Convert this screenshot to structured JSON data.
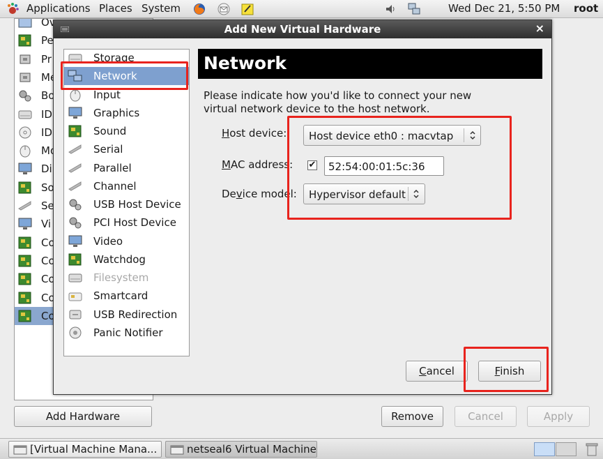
{
  "top_panel": {
    "menus": [
      "Applications",
      "Places",
      "System"
    ],
    "clock": "Wed Dec 21,  5:50 PM",
    "user": "root"
  },
  "background_window": {
    "hardware_items": [
      {
        "label": "Ov",
        "icon": "overview-icon"
      },
      {
        "label": "Pe",
        "icon": "performance-icon"
      },
      {
        "label": "Pr",
        "icon": "processor-icon"
      },
      {
        "label": "Me",
        "icon": "memory-icon"
      },
      {
        "label": "Bo",
        "icon": "boot-options-icon"
      },
      {
        "label": "ID",
        "icon": "disk-icon"
      },
      {
        "label": "ID",
        "icon": "cdrom-icon"
      },
      {
        "label": "Mo",
        "icon": "mouse-icon"
      },
      {
        "label": "Di",
        "icon": "display-icon"
      },
      {
        "label": "So",
        "icon": "sound-icon"
      },
      {
        "label": "Se",
        "icon": "serial-icon"
      },
      {
        "label": "Vi",
        "icon": "video-icon"
      },
      {
        "label": "Co",
        "icon": "controller-icon"
      },
      {
        "label": "Co",
        "icon": "controller-icon"
      },
      {
        "label": "Co",
        "icon": "controller-icon"
      },
      {
        "label": "Co",
        "icon": "controller-icon"
      },
      {
        "label": "Co",
        "icon": "controller-icon"
      }
    ],
    "add_hardware_label": "Add Hardware",
    "remove_label": "Remove",
    "cancel_label": "Cancel",
    "apply_label": "Apply"
  },
  "dialog": {
    "title": "Add New Virtual Hardware",
    "close_glyph": "×",
    "hardware_list": [
      {
        "label": "Storage",
        "icon": "storage-icon"
      },
      {
        "label": "Network",
        "icon": "network-icon"
      },
      {
        "label": "Input",
        "icon": "input-icon"
      },
      {
        "label": "Graphics",
        "icon": "graphics-icon"
      },
      {
        "label": "Sound",
        "icon": "sound-card-icon"
      },
      {
        "label": "Serial",
        "icon": "serial-port-icon"
      },
      {
        "label": "Parallel",
        "icon": "parallel-port-icon"
      },
      {
        "label": "Channel",
        "icon": "channel-icon"
      },
      {
        "label": "USB Host Device",
        "icon": "usb-host-icon"
      },
      {
        "label": "PCI Host Device",
        "icon": "pci-host-icon"
      },
      {
        "label": "Video",
        "icon": "video-card-icon"
      },
      {
        "label": "Watchdog",
        "icon": "watchdog-icon"
      },
      {
        "label": "Filesystem",
        "icon": "filesystem-icon"
      },
      {
        "label": "Smartcard",
        "icon": "smartcard-icon"
      },
      {
        "label": "USB Redirection",
        "icon": "usb-redirection-icon"
      },
      {
        "label": "Panic Notifier",
        "icon": "panic-notifier-icon"
      }
    ],
    "selected_index": 1,
    "disabled_index": 12,
    "banner_title": "Network",
    "description": "Please indicate how you'd like to connect your new virtual network device to the host network.",
    "host_device_label": "Host device:",
    "host_device_value": "Host device eth0 : macvtap",
    "mac_address_label": "MAC address:",
    "mac_address_checked": true,
    "mac_address_value": "52:54:00:01:5c:36",
    "device_model_label": "Device model:",
    "device_model_value": "Hypervisor default",
    "cancel_label": "Cancel",
    "finish_label": "Finish"
  },
  "taskbar": {
    "tasks": [
      "[Virtual Machine Mana...",
      "netseal6 Virtual Machine"
    ]
  },
  "colors": {
    "selection": "#7ea0cf",
    "highlight_box": "#e8231d",
    "titlebar": "#3a3a3a"
  }
}
